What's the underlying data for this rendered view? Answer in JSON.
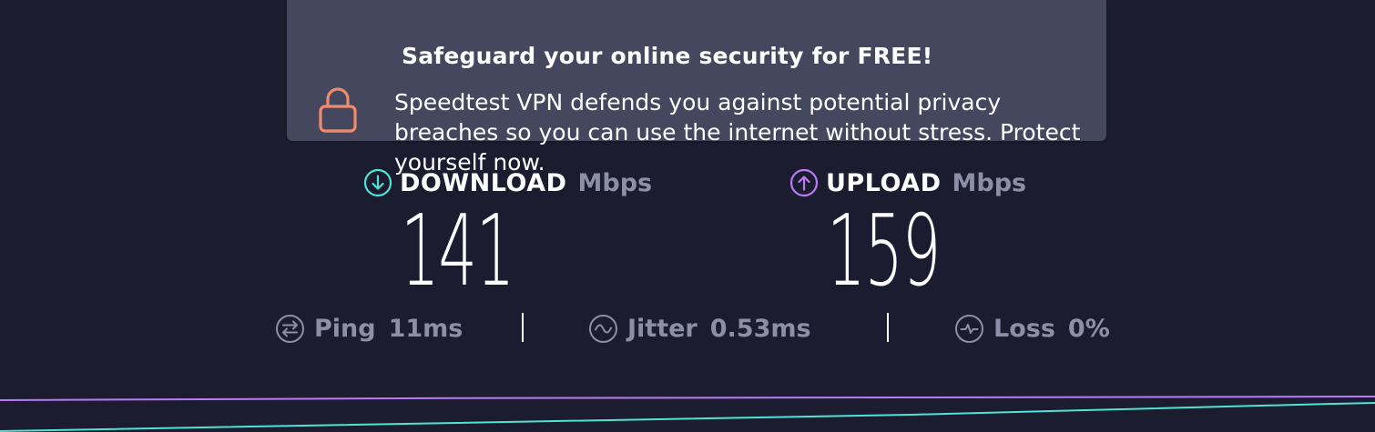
{
  "banner": {
    "title": "Safeguard your online security for FREE!",
    "body": "Speedtest VPN defends you against potential privacy breaches so you can use the internet without stress. Protect yourself now.",
    "icon": "lock-icon"
  },
  "download": {
    "label": "DOWNLOAD",
    "unit": "Mbps",
    "value": "141",
    "icon": "arrow-down-circle-icon",
    "color": "#4fe3d6"
  },
  "upload": {
    "label": "UPLOAD",
    "unit": "Mbps",
    "value": "159",
    "icon": "arrow-up-circle-icon",
    "color": "#b77cf5"
  },
  "stats": {
    "ping": {
      "label": "Ping",
      "value": "11ms",
      "icon": "ping-icon"
    },
    "jitter": {
      "label": "Jitter",
      "value": "0.53ms",
      "icon": "jitter-icon"
    },
    "loss": {
      "label": "Loss",
      "value": "0%",
      "icon": "loss-icon"
    }
  },
  "colors": {
    "background": "#1b1c2f",
    "banner": "#45475f",
    "lock": "#f08a6b",
    "muted": "#8d8fa6",
    "upload_line": "#b77cf5",
    "download_line": "#4fe3d6"
  }
}
